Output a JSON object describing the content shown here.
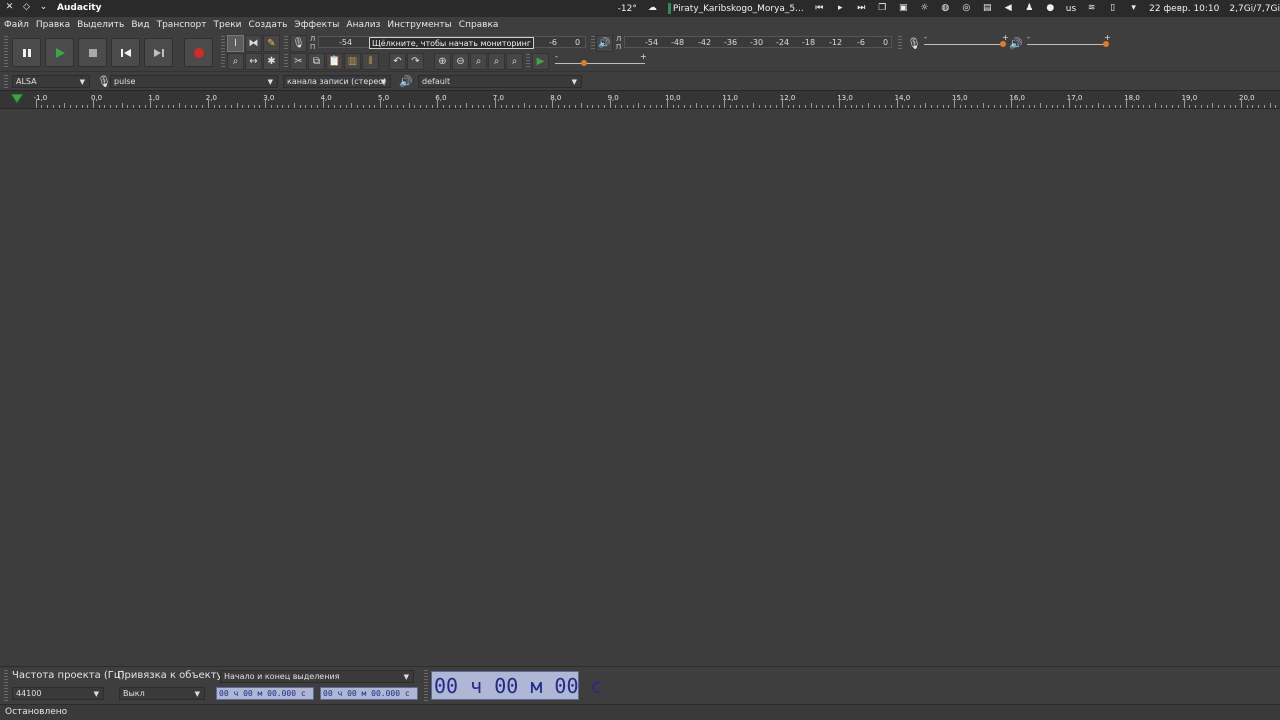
{
  "panel": {
    "app_title": "Audacity",
    "temperature": "-12°",
    "media_title": "Piraty_Karibskogo_Morya_5...",
    "keyboard_layout": "us",
    "datetime": "22 февр. 10:10",
    "memory": "2,7Gi/7,7Gi"
  },
  "menu": [
    "Файл",
    "Правка",
    "Выделить",
    "Вид",
    "Транспорт",
    "Треки",
    "Создать",
    "Эффекты",
    "Анализ",
    "Инструменты",
    "Справка"
  ],
  "meters": {
    "record_lr": [
      "Л",
      "П"
    ],
    "record_scale": [
      "-54",
      "-6",
      "0"
    ],
    "record_tooltip": "Щёлкните, чтобы начать мониторинг",
    "play_lr": [
      "Л",
      "П"
    ],
    "play_scale": [
      "-54",
      "-48",
      "-42",
      "-36",
      "-30",
      "-24",
      "-18",
      "-12",
      "-6",
      "0"
    ]
  },
  "sliders": {
    "minus": "-",
    "plus": "+"
  },
  "devices": {
    "host": "ALSA",
    "record_device": "pulse",
    "channels": "канала записи (стерео)",
    "playback_device": "default"
  },
  "ruler": {
    "labels": [
      "-1,0",
      "0,0",
      "1,0",
      "2,0",
      "3,0",
      "4,0",
      "5,0",
      "6,0",
      "7,0",
      "8,0",
      "9,0",
      "10,0",
      "11,0",
      "12,0",
      "13,0",
      "14,0",
      "15,0",
      "16,0",
      "17,0",
      "18,0",
      "19,0",
      "20,0"
    ]
  },
  "selection_bar": {
    "rate_label": "Частота проекта (Гц)",
    "rate_value": "44100",
    "snap_label": "Привязка к объекту",
    "snap_value": "Выкл",
    "sel_mode": "Начало и конец выделения",
    "start_time": "00 ч 00 м 00.000 с",
    "end_time": "00 ч 00 м 00.000 с",
    "big_time": "00 ч 00 м 00 с"
  },
  "status": "Остановлено",
  "colors": {
    "record_red": "#d42a2a",
    "play_green": "#3aa745",
    "slider_orange": "#e07b26",
    "time_bg": "#aeb7d3",
    "time_fg": "#242a8a"
  }
}
